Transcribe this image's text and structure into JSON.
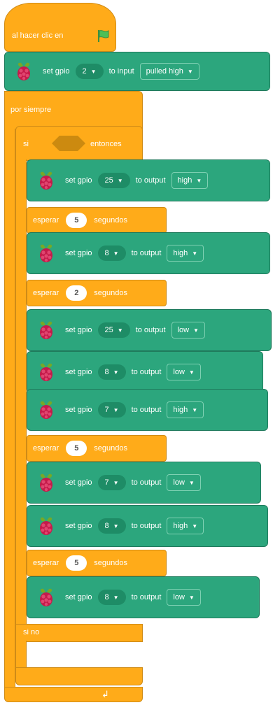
{
  "hat": {
    "label": "al hacer clic en",
    "flag_icon": "green-flag-icon"
  },
  "top_block": {
    "set_label": "set gpio",
    "pin": "2",
    "mode_label": "to input",
    "value": "pulled high"
  },
  "forever": {
    "label": "por siempre"
  },
  "if_else": {
    "if_label": "si",
    "then_label": "entonces",
    "else_label": "si no"
  },
  "colors": {
    "control": "#FFAB19",
    "extension": "#2CA67D",
    "flag": "#4CBF56"
  },
  "then_blocks": [
    {
      "kind": "gpio",
      "set_label": "set gpio",
      "pin": "25",
      "mode_label": "to output",
      "value": "high"
    },
    {
      "kind": "wait",
      "pre": "esperar",
      "seconds": "5",
      "post": "segundos"
    },
    {
      "kind": "gpio",
      "set_label": "set gpio",
      "pin": "8",
      "mode_label": "to output",
      "value": "high"
    },
    {
      "kind": "wait",
      "pre": "esperar",
      "seconds": "2",
      "post": "segundos"
    },
    {
      "kind": "gpio",
      "set_label": "set gpio",
      "pin": "25",
      "mode_label": "to output",
      "value": "low"
    },
    {
      "kind": "gpio",
      "set_label": "set gpio",
      "pin": "8",
      "mode_label": "to output",
      "value": "low"
    },
    {
      "kind": "gpio",
      "set_label": "set gpio",
      "pin": "7",
      "mode_label": "to output",
      "value": "high"
    },
    {
      "kind": "wait",
      "pre": "esperar",
      "seconds": "5",
      "post": "segundos"
    },
    {
      "kind": "gpio",
      "set_label": "set gpio",
      "pin": "7",
      "mode_label": "to output",
      "value": "low"
    },
    {
      "kind": "gpio",
      "set_label": "set gpio",
      "pin": "8",
      "mode_label": "to output",
      "value": "high"
    },
    {
      "kind": "wait",
      "pre": "esperar",
      "seconds": "5",
      "post": "segundos"
    },
    {
      "kind": "gpio",
      "set_label": "set gpio",
      "pin": "8",
      "mode_label": "to output",
      "value": "low"
    }
  ]
}
